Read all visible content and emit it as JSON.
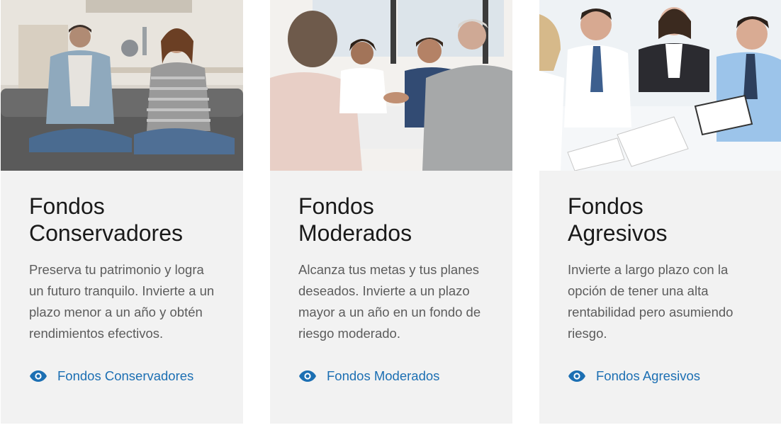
{
  "colors": {
    "card_background": "#f2f2f2",
    "title": "#1a1a1a",
    "description": "#5c5c5c",
    "link": "#1c6fb3"
  },
  "cards": [
    {
      "title_line1": "Fondos",
      "title_line2": "Conservadores",
      "description": "Preserva tu patrimonio y logra un futuro tranquilo. Invierte a un plazo menor a un año y obtén rendimientos efectivos.",
      "link_label": "Fondos Conservadores",
      "link_icon": "eye-icon",
      "image": "couple-meditating-photo"
    },
    {
      "title_line1": "Fondos",
      "title_line2": "Moderados",
      "description": "Alcanza tus metas y tus planes deseados. Invierte a un plazo mayor a un año en un fondo de riesgo moderado.",
      "link_label": "Fondos Moderados",
      "link_icon": "eye-icon",
      "image": "business-handshake-photo"
    },
    {
      "title_line1": "Fondos",
      "title_line2": "Agresivos",
      "description": "Invierte a largo plazo con la opción de tener una alta rentabilidad pero asumiendo riesgo.",
      "link_label": "Fondos Agresivos",
      "link_icon": "eye-icon",
      "image": "team-meeting-photo"
    }
  ]
}
